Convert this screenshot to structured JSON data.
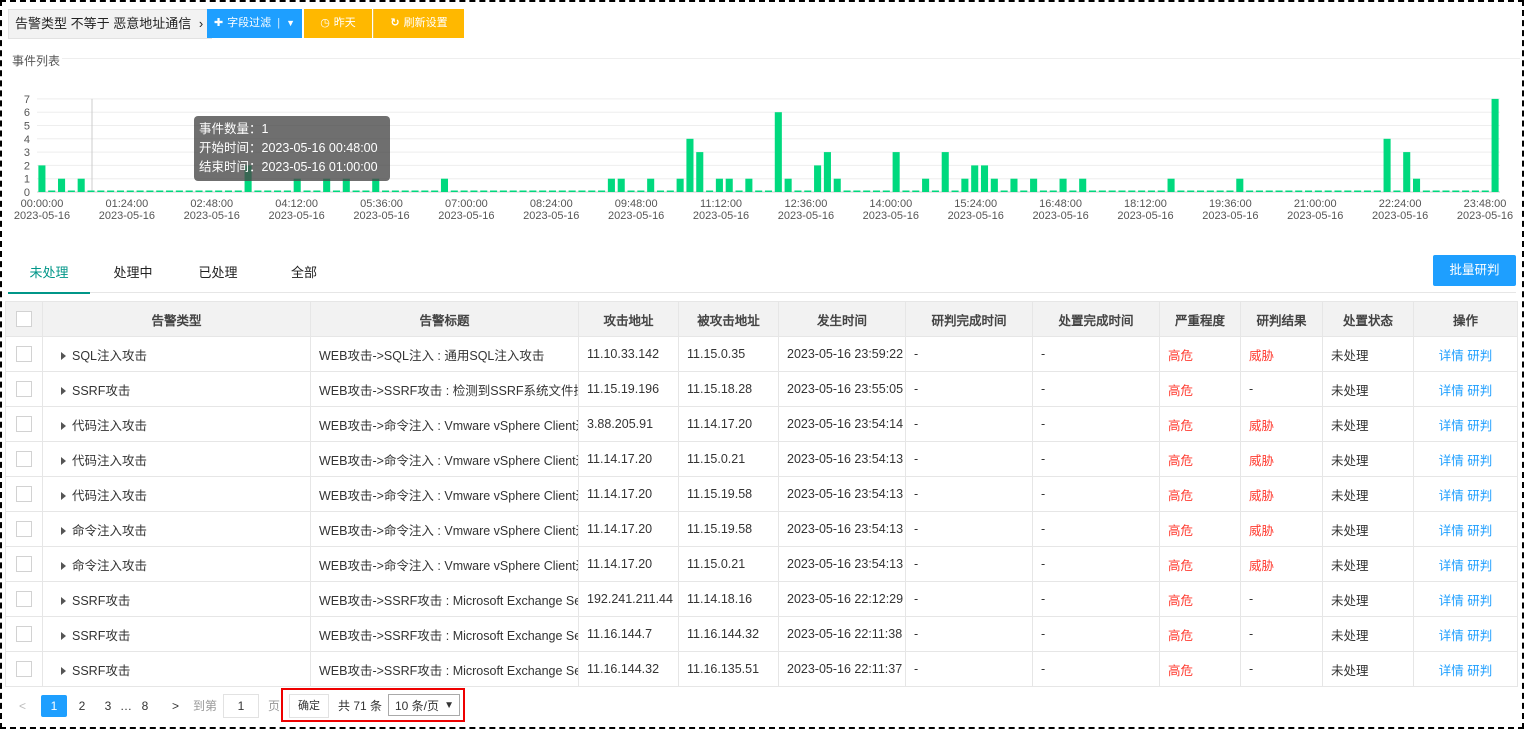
{
  "toolbar": {
    "filter_tag": "告警类型 不等于 恶意地址通信",
    "filter_chevron": "›",
    "field_filter_label": "字段过滤",
    "field_filter_sep": "|",
    "yesterday_label": "昨天",
    "refresh_label": "刷新设置"
  },
  "section_title": "事件列表",
  "chart_data": {
    "type": "bar",
    "color": "#00d97e",
    "ylim": [
      0,
      7
    ],
    "yticks": [
      "0",
      "1",
      "2",
      "3",
      "4",
      "5",
      "6",
      "7"
    ],
    "values": [
      2,
      0,
      1,
      0,
      1,
      0,
      0,
      0,
      0,
      0,
      0,
      0,
      0,
      0,
      0,
      0,
      0,
      0,
      0,
      0,
      0,
      2,
      0,
      0,
      0,
      0,
      1,
      0,
      0,
      1,
      0,
      1,
      0,
      0,
      1,
      0,
      0,
      0,
      0,
      0,
      0,
      1,
      0,
      0,
      0,
      0,
      0,
      0,
      0,
      0,
      0,
      0,
      0,
      0,
      0,
      0,
      0,
      0,
      1,
      1,
      0,
      0,
      1,
      0,
      0,
      1,
      4,
      3,
      0,
      1,
      1,
      0,
      1,
      0,
      0,
      6,
      1,
      0,
      0,
      2,
      3,
      1,
      0,
      0,
      0,
      0,
      0,
      3,
      0,
      0,
      1,
      0,
      3,
      0,
      1,
      2,
      2,
      1,
      0,
      1,
      0,
      1,
      0,
      0,
      1,
      0,
      1,
      0,
      0,
      0,
      0,
      0,
      0,
      0,
      0,
      1,
      0,
      0,
      0,
      0,
      0,
      0,
      1,
      0,
      0,
      0,
      0,
      0,
      0,
      0,
      0,
      0,
      0,
      0,
      0,
      0,
      0,
      4,
      0,
      3,
      1,
      0,
      0,
      0,
      0,
      0,
      0,
      0,
      7
    ],
    "xticks": [
      {
        "t": "00:00:00",
        "d": "2023-05-16"
      },
      {
        "t": "01:24:00",
        "d": "2023-05-16"
      },
      {
        "t": "02:48:00",
        "d": "2023-05-16"
      },
      {
        "t": "04:12:00",
        "d": "2023-05-16"
      },
      {
        "t": "05:36:00",
        "d": "2023-05-16"
      },
      {
        "t": "07:00:00",
        "d": "2023-05-16"
      },
      {
        "t": "08:24:00",
        "d": "2023-05-16"
      },
      {
        "t": "09:48:00",
        "d": "2023-05-16"
      },
      {
        "t": "11:12:00",
        "d": "2023-05-16"
      },
      {
        "t": "12:36:00",
        "d": "2023-05-16"
      },
      {
        "t": "14:00:00",
        "d": "2023-05-16"
      },
      {
        "t": "15:24:00",
        "d": "2023-05-16"
      },
      {
        "t": "16:48:00",
        "d": "2023-05-16"
      },
      {
        "t": "18:12:00",
        "d": "2023-05-16"
      },
      {
        "t": "19:36:00",
        "d": "2023-05-16"
      },
      {
        "t": "21:00:00",
        "d": "2023-05-16"
      },
      {
        "t": "22:24:00",
        "d": "2023-05-16"
      },
      {
        "t": "23:48:00",
        "d": "2023-05-16"
      }
    ],
    "tooltip": {
      "count_label": "事件数量：",
      "count_value": "1",
      "start_label": "开始时间：",
      "start_value": "2023-05-16 00:48:00",
      "end_label": "结束时间：",
      "end_value": "2023-05-16 01:00:00"
    }
  },
  "tabs": [
    "未处理",
    "处理中",
    "已处理",
    "全部"
  ],
  "batch_button": "批量研判",
  "table": {
    "headers": [
      "告警类型",
      "告警标题",
      "攻击地址",
      "被攻击地址",
      "发生时间",
      "研判完成时间",
      "处置完成时间",
      "严重程度",
      "研判结果",
      "处置状态",
      "操作"
    ],
    "rows": [
      [
        "SQL注入攻击",
        "WEB攻击->SQL注入 : 通用SQL注入攻击",
        "11.10.33.142",
        "11.15.0.35",
        "2023-05-16 23:59:22",
        "-",
        "-",
        "高危",
        "威胁",
        "未处理"
      ],
      [
        "SSRF攻击",
        "WEB攻击->SSRF攻击 : 检测到SSRF系统文件探测",
        "11.15.19.196",
        "11.15.18.28",
        "2023-05-16 23:55:05",
        "-",
        "-",
        "高危",
        "-",
        "未处理"
      ],
      [
        "代码注入攻击",
        "WEB攻击->命令注入 : Vmware vSphere Client远程",
        "3.88.205.91",
        "11.14.17.20",
        "2023-05-16 23:54:14",
        "-",
        "-",
        "高危",
        "威胁",
        "未处理"
      ],
      [
        "代码注入攻击",
        "WEB攻击->命令注入 : Vmware vSphere Client远程",
        "11.14.17.20",
        "11.15.0.21",
        "2023-05-16 23:54:13",
        "-",
        "-",
        "高危",
        "威胁",
        "未处理"
      ],
      [
        "代码注入攻击",
        "WEB攻击->命令注入 : Vmware vSphere Client远程",
        "11.14.17.20",
        "11.15.19.58",
        "2023-05-16 23:54:13",
        "-",
        "-",
        "高危",
        "威胁",
        "未处理"
      ],
      [
        "命令注入攻击",
        "WEB攻击->命令注入 : Vmware vSphere Client远程",
        "11.14.17.20",
        "11.15.19.58",
        "2023-05-16 23:54:13",
        "-",
        "-",
        "高危",
        "威胁",
        "未处理"
      ],
      [
        "命令注入攻击",
        "WEB攻击->命令注入 : Vmware vSphere Client远程",
        "11.14.17.20",
        "11.15.0.21",
        "2023-05-16 23:54:13",
        "-",
        "-",
        "高危",
        "威胁",
        "未处理"
      ],
      [
        "SSRF攻击",
        "WEB攻击->SSRF攻击 : Microsoft Exchange Serve",
        "192.241.211.44",
        "11.14.18.16",
        "2023-05-16 22:12:29",
        "-",
        "-",
        "高危",
        "-",
        "未处理"
      ],
      [
        "SSRF攻击",
        "WEB攻击->SSRF攻击 : Microsoft Exchange Serve",
        "11.16.144.7",
        "11.16.144.32",
        "2023-05-16 22:11:38",
        "-",
        "-",
        "高危",
        "-",
        "未处理"
      ],
      [
        "SSRF攻击",
        "WEB攻击->SSRF攻击 : Microsoft Exchange Serve",
        "11.16.144.32",
        "11.16.135.51",
        "2023-05-16 22:11:37",
        "-",
        "-",
        "高危",
        "-",
        "未处理"
      ]
    ],
    "action_detail": "详情",
    "action_judge": "研判"
  },
  "pagination": {
    "prev": "<",
    "pages": [
      "1",
      "2",
      "3"
    ],
    "ellipsis": "…",
    "last_page": "8",
    "next": ">",
    "goto_label": "到第",
    "goto_value": "1",
    "page_unit": "页",
    "ok": "确定",
    "total": "共 71 条",
    "page_size": "10 条/页"
  }
}
